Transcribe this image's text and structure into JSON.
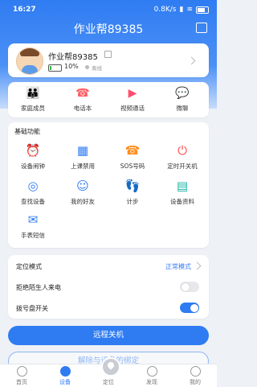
{
  "status_bar": {
    "time": "16:27",
    "network": "0.8K/s"
  },
  "header": {
    "title": "作业帮89385"
  },
  "profile": {
    "name": "作业帮89385",
    "battery": "10%",
    "status": "离线"
  },
  "quick_actions": [
    {
      "label": "家庭成员",
      "icon": "family-icon",
      "color": "#2f7cf2"
    },
    {
      "label": "电话本",
      "icon": "phonebook-icon",
      "color": "#ff5a5f"
    },
    {
      "label": "视频通话",
      "icon": "video-call-icon",
      "color": "#ff4d6d"
    },
    {
      "label": "微聊",
      "icon": "chat-icon",
      "color": "#ff7a45"
    }
  ],
  "functions": {
    "title": "基础功能",
    "items": [
      {
        "label": "设备闹钟",
        "icon": "alarm-icon",
        "color": "#ff5a5f"
      },
      {
        "label": "上课禁用",
        "icon": "class-ban-icon",
        "color": "#2f7cf2"
      },
      {
        "label": "SOS号码",
        "icon": "sos-icon",
        "color": "#ff8c1a"
      },
      {
        "label": "定时开关机",
        "icon": "power-timer-icon",
        "color": "#ff4d4f"
      },
      {
        "label": "查找设备",
        "icon": "find-device-icon",
        "color": "#2f7cf2"
      },
      {
        "label": "我的好友",
        "icon": "friends-icon",
        "color": "#2f7cf2"
      },
      {
        "label": "计步",
        "icon": "steps-icon",
        "color": "#2bb673"
      },
      {
        "label": "设备资料",
        "icon": "device-info-icon",
        "color": "#17b3a3"
      },
      {
        "label": "手表短信",
        "icon": "sms-icon",
        "color": "#2f7cf2"
      }
    ]
  },
  "settings": {
    "location_mode": {
      "label": "定位模式",
      "value": "正常模式"
    },
    "reject_strangers": {
      "label": "拒绝陌生人来电",
      "on": false
    },
    "dial_switch": {
      "label": "拨号盘开关",
      "on": true
    }
  },
  "buttons": {
    "remote_shutdown": "远程关机",
    "unbind": "解除与设备的绑定"
  },
  "tabs": [
    {
      "label": "首页",
      "active": false
    },
    {
      "label": "设备",
      "active": true
    },
    {
      "label": "定位",
      "active": false
    },
    {
      "label": "发现",
      "active": false
    },
    {
      "label": "我的",
      "active": false
    }
  ]
}
